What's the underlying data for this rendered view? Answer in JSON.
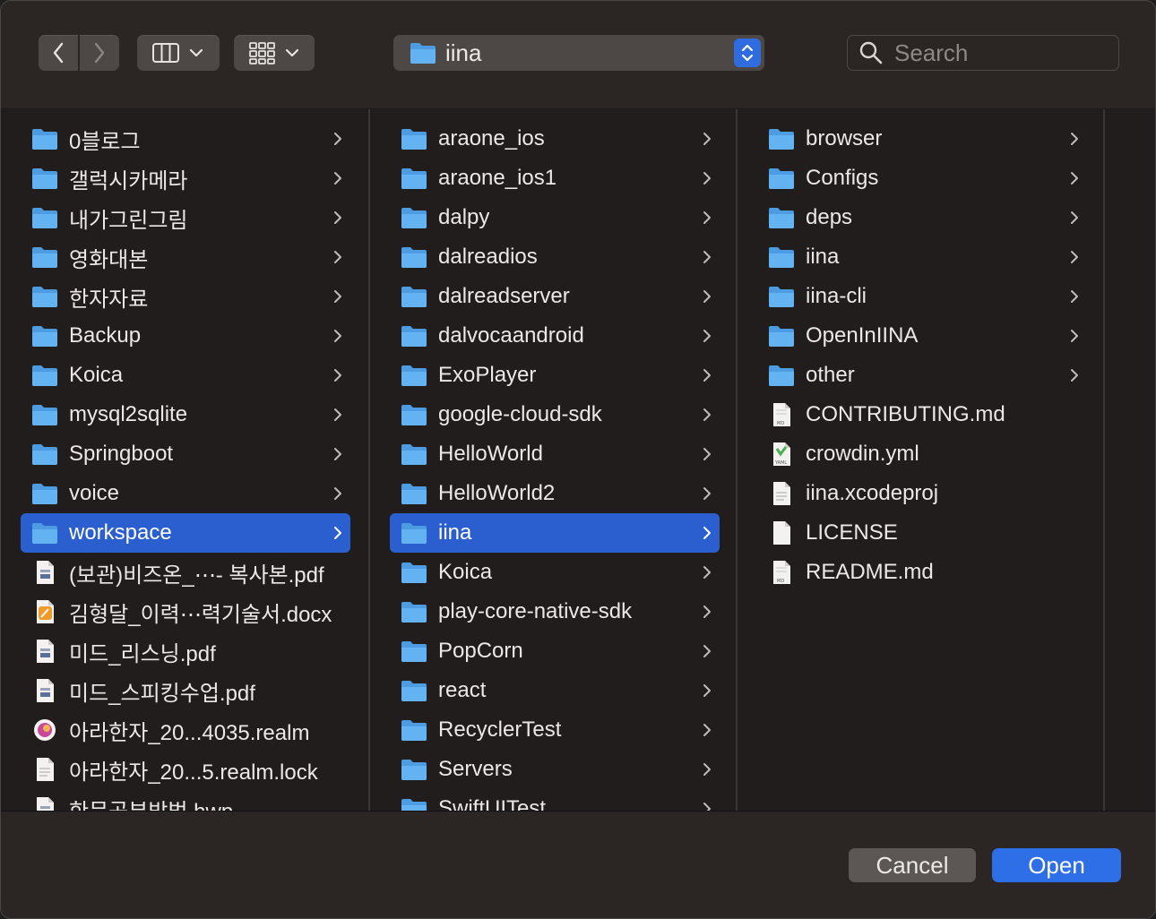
{
  "toolbar": {
    "back_icon": "chevron-left-icon",
    "forward_icon": "chevron-right-icon",
    "view_mode_icon": "column-view-icon",
    "group_icon": "icon-grid-icon",
    "location": "iina",
    "search_placeholder": "Search"
  },
  "columns": [
    {
      "items": [
        {
          "name": "0블로그",
          "type": "folder",
          "selected": false
        },
        {
          "name": "갤럭시카메라",
          "type": "folder",
          "selected": false
        },
        {
          "name": "내가그린그림",
          "type": "folder",
          "selected": false
        },
        {
          "name": "영화대본",
          "type": "folder",
          "selected": false
        },
        {
          "name": "한자자료",
          "type": "folder",
          "selected": false
        },
        {
          "name": "Backup",
          "type": "folder",
          "selected": false
        },
        {
          "name": "Koica",
          "type": "folder",
          "selected": false
        },
        {
          "name": "mysql2sqlite",
          "type": "folder",
          "selected": false
        },
        {
          "name": "Springboot",
          "type": "folder",
          "selected": false
        },
        {
          "name": "voice",
          "type": "folder",
          "selected": false
        },
        {
          "name": "workspace",
          "type": "folder",
          "selected": true
        },
        {
          "name": "(보관)비즈온_⋯- 복사본.pdf",
          "type": "pdf",
          "selected": false
        },
        {
          "name": "김형달_이력⋯력기술서.docx",
          "type": "pages",
          "selected": false
        },
        {
          "name": "미드_리스닝.pdf",
          "type": "pdf",
          "selected": false
        },
        {
          "name": "미드_스피킹수업.pdf",
          "type": "pdf",
          "selected": false
        },
        {
          "name": "아라한자_20...4035.realm",
          "type": "realm",
          "selected": false
        },
        {
          "name": "아라한자_20...5.realm.lock",
          "type": "doc",
          "selected": false
        },
        {
          "name": "한문공부방법.hwp",
          "type": "pdf",
          "selected": false
        }
      ]
    },
    {
      "items": [
        {
          "name": "araone_ios",
          "type": "folder",
          "selected": false
        },
        {
          "name": "araone_ios1",
          "type": "folder",
          "selected": false
        },
        {
          "name": "dalpy",
          "type": "folder",
          "selected": false
        },
        {
          "name": "dalreadios",
          "type": "folder",
          "selected": false
        },
        {
          "name": "dalreadserver",
          "type": "folder",
          "selected": false
        },
        {
          "name": "dalvocaandroid",
          "type": "folder",
          "selected": false
        },
        {
          "name": "ExoPlayer",
          "type": "folder",
          "selected": false
        },
        {
          "name": "google-cloud-sdk",
          "type": "folder",
          "selected": false
        },
        {
          "name": "HelloWorld",
          "type": "folder",
          "selected": false
        },
        {
          "name": "HelloWorld2",
          "type": "folder",
          "selected": false
        },
        {
          "name": "iina",
          "type": "folder",
          "selected": true
        },
        {
          "name": "Koica",
          "type": "folder",
          "selected": false
        },
        {
          "name": "play-core-native-sdk",
          "type": "folder",
          "selected": false
        },
        {
          "name": "PopCorn",
          "type": "folder",
          "selected": false
        },
        {
          "name": "react",
          "type": "folder",
          "selected": false
        },
        {
          "name": "RecyclerTest",
          "type": "folder",
          "selected": false
        },
        {
          "name": "Servers",
          "type": "folder",
          "selected": false
        },
        {
          "name": "SwiftUITest",
          "type": "folder",
          "selected": false
        }
      ]
    },
    {
      "items": [
        {
          "name": "browser",
          "type": "folder",
          "selected": false
        },
        {
          "name": "Configs",
          "type": "folder",
          "selected": false
        },
        {
          "name": "deps",
          "type": "folder",
          "selected": false
        },
        {
          "name": "iina",
          "type": "folder",
          "selected": false
        },
        {
          "name": "iina-cli",
          "type": "folder",
          "selected": false
        },
        {
          "name": "OpenInIINA",
          "type": "folder",
          "selected": false
        },
        {
          "name": "other",
          "type": "folder",
          "selected": false
        },
        {
          "name": "CONTRIBUTING.md",
          "type": "md",
          "selected": false
        },
        {
          "name": "crowdin.yml",
          "type": "yaml",
          "selected": false
        },
        {
          "name": "iina.xcodeproj",
          "type": "doc",
          "selected": false
        },
        {
          "name": "LICENSE",
          "type": "blank",
          "selected": false
        },
        {
          "name": "README.md",
          "type": "md",
          "selected": false
        }
      ]
    }
  ],
  "footer": {
    "cancel_label": "Cancel",
    "open_label": "Open"
  },
  "colors": {
    "selection": "#2b5fd0",
    "folder": "#5aa9ee",
    "primary_button": "#2e6ee6"
  }
}
